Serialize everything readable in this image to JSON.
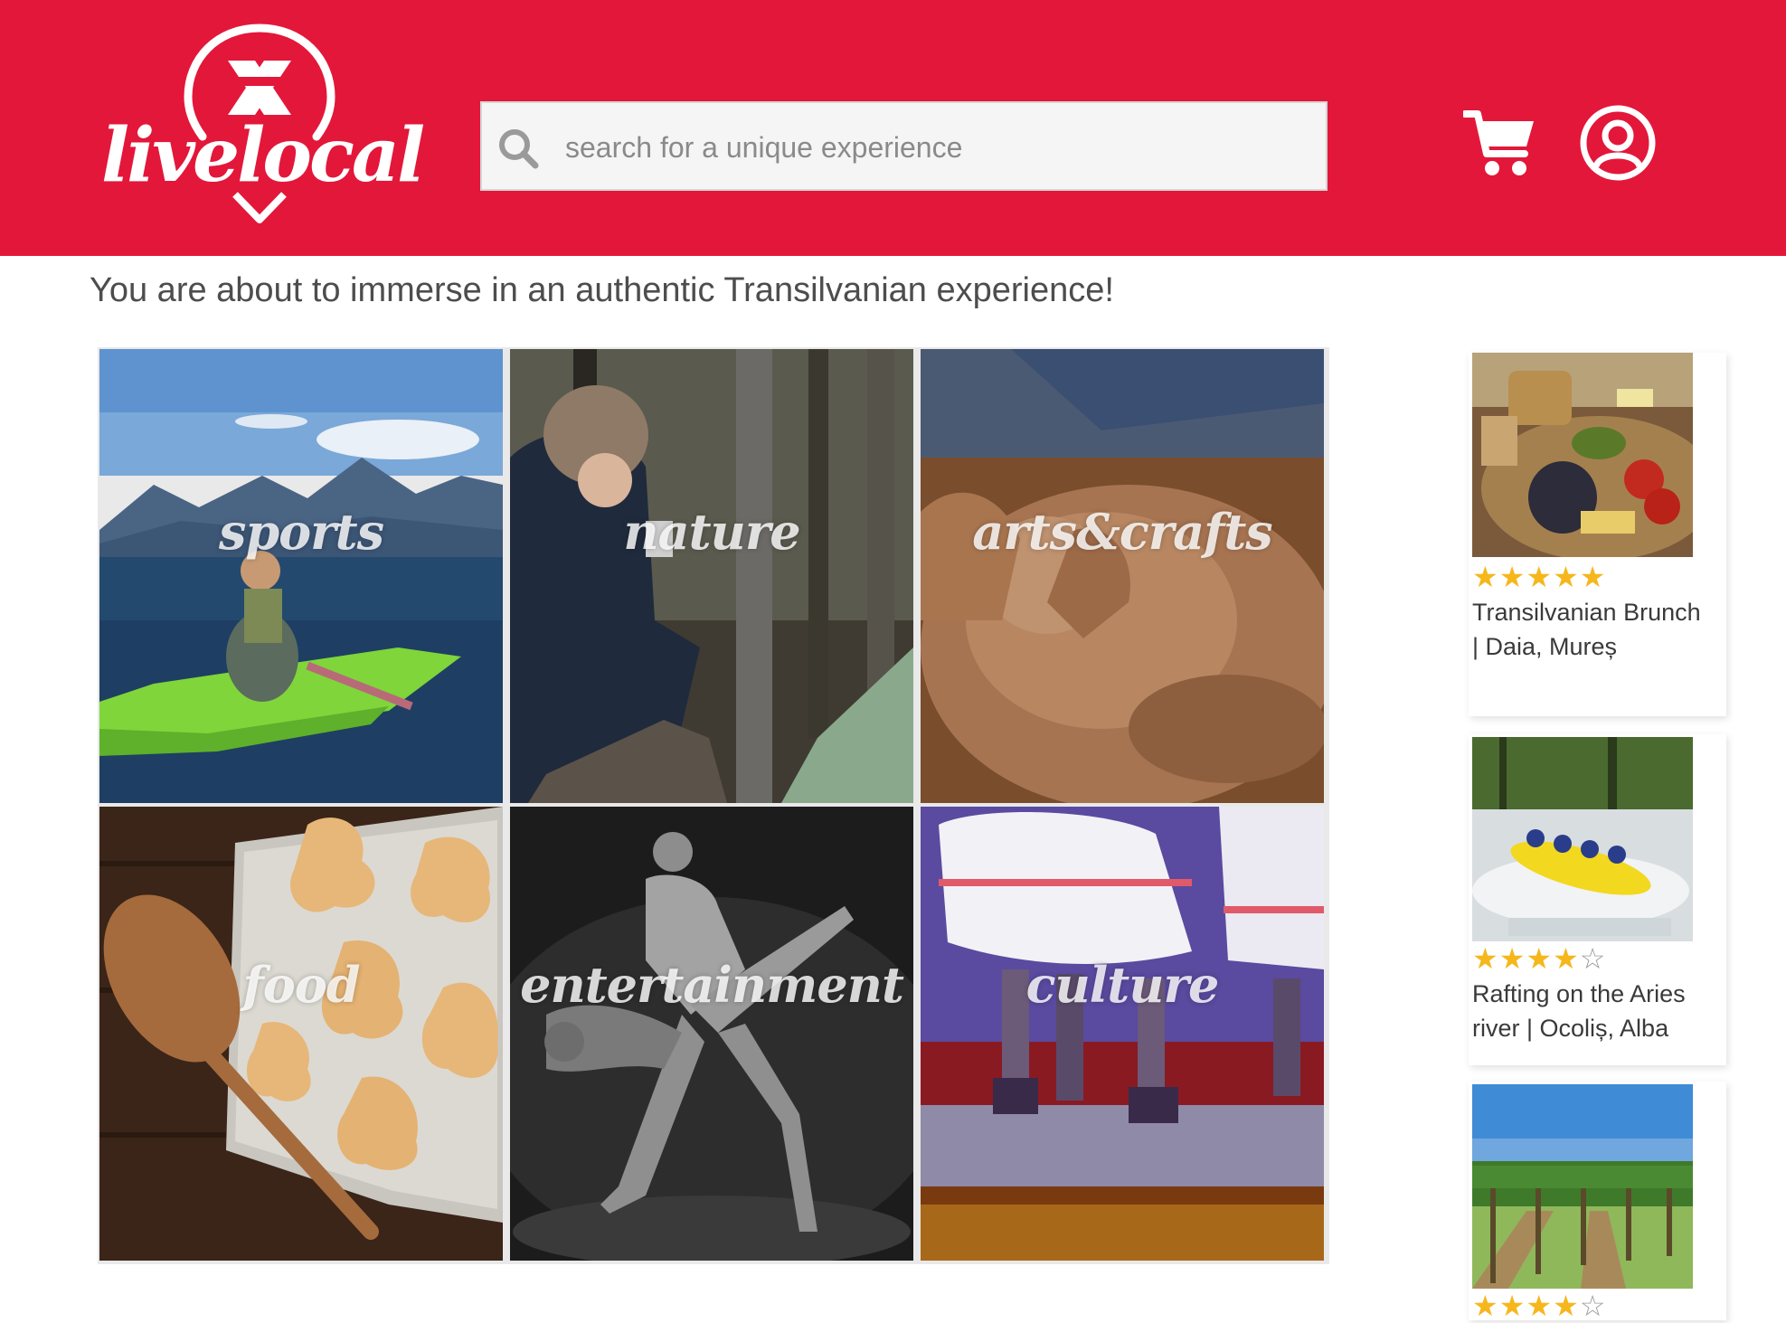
{
  "brand": {
    "name": "livelocal"
  },
  "search": {
    "placeholder": "search for a unique experience"
  },
  "header": {
    "cart_icon": "shopping-cart-icon",
    "user_icon": "user-account-icon"
  },
  "intro": {
    "text": "You are about to immerse in an authentic Transilvanian experience!"
  },
  "categories": [
    {
      "label": "sports"
    },
    {
      "label": "nature"
    },
    {
      "label": "arts&crafts"
    },
    {
      "label": "food"
    },
    {
      "label": "entertainment"
    },
    {
      "label": "culture"
    }
  ],
  "experiences": [
    {
      "title": "Transilvanian Brunch | Daia, Mureș",
      "rating": 5,
      "max_rating": 5
    },
    {
      "title": "Rafting on the Aries river | Ocoliș, Alba",
      "rating": 4,
      "max_rating": 5
    },
    {
      "title": "",
      "rating": 4,
      "max_rating": 5
    }
  ],
  "colors": {
    "brand_red": "#e3173a",
    "star_gold": "#f5b71c",
    "text": "#4a4a4a"
  }
}
